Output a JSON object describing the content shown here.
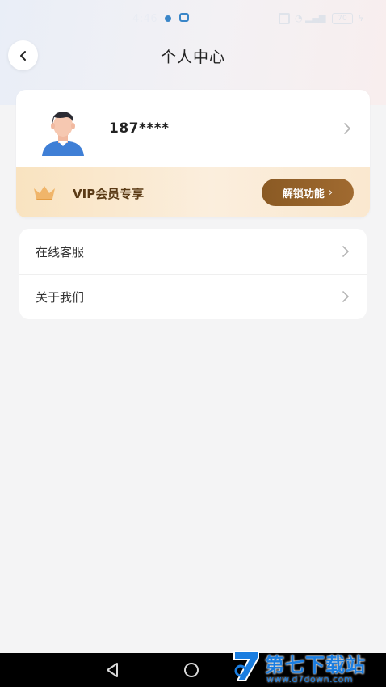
{
  "status_bar": {
    "time": "4:46",
    "battery": "70"
  },
  "header": {
    "title": "个人中心"
  },
  "profile": {
    "username": "187****"
  },
  "vip": {
    "label": "VIP会员专享",
    "button_label": "解锁功能",
    "button_chevron": "›"
  },
  "menu": {
    "items": [
      {
        "label": "在线客服"
      },
      {
        "label": "关于我们"
      }
    ]
  },
  "watermark": {
    "title": "第七下载站",
    "url": "www.d7down.com"
  },
  "colors": {
    "accent_brown": "#8a5a24",
    "vip_bg": "#f9e3c0",
    "page_bg": "#f4f4f5",
    "watermark_blue": "#1a7de0"
  },
  "icons": {
    "back": "chevron-left-icon",
    "chevron": "chevron-right-icon",
    "crown": "crown-icon",
    "avatar": "avatar-icon"
  }
}
